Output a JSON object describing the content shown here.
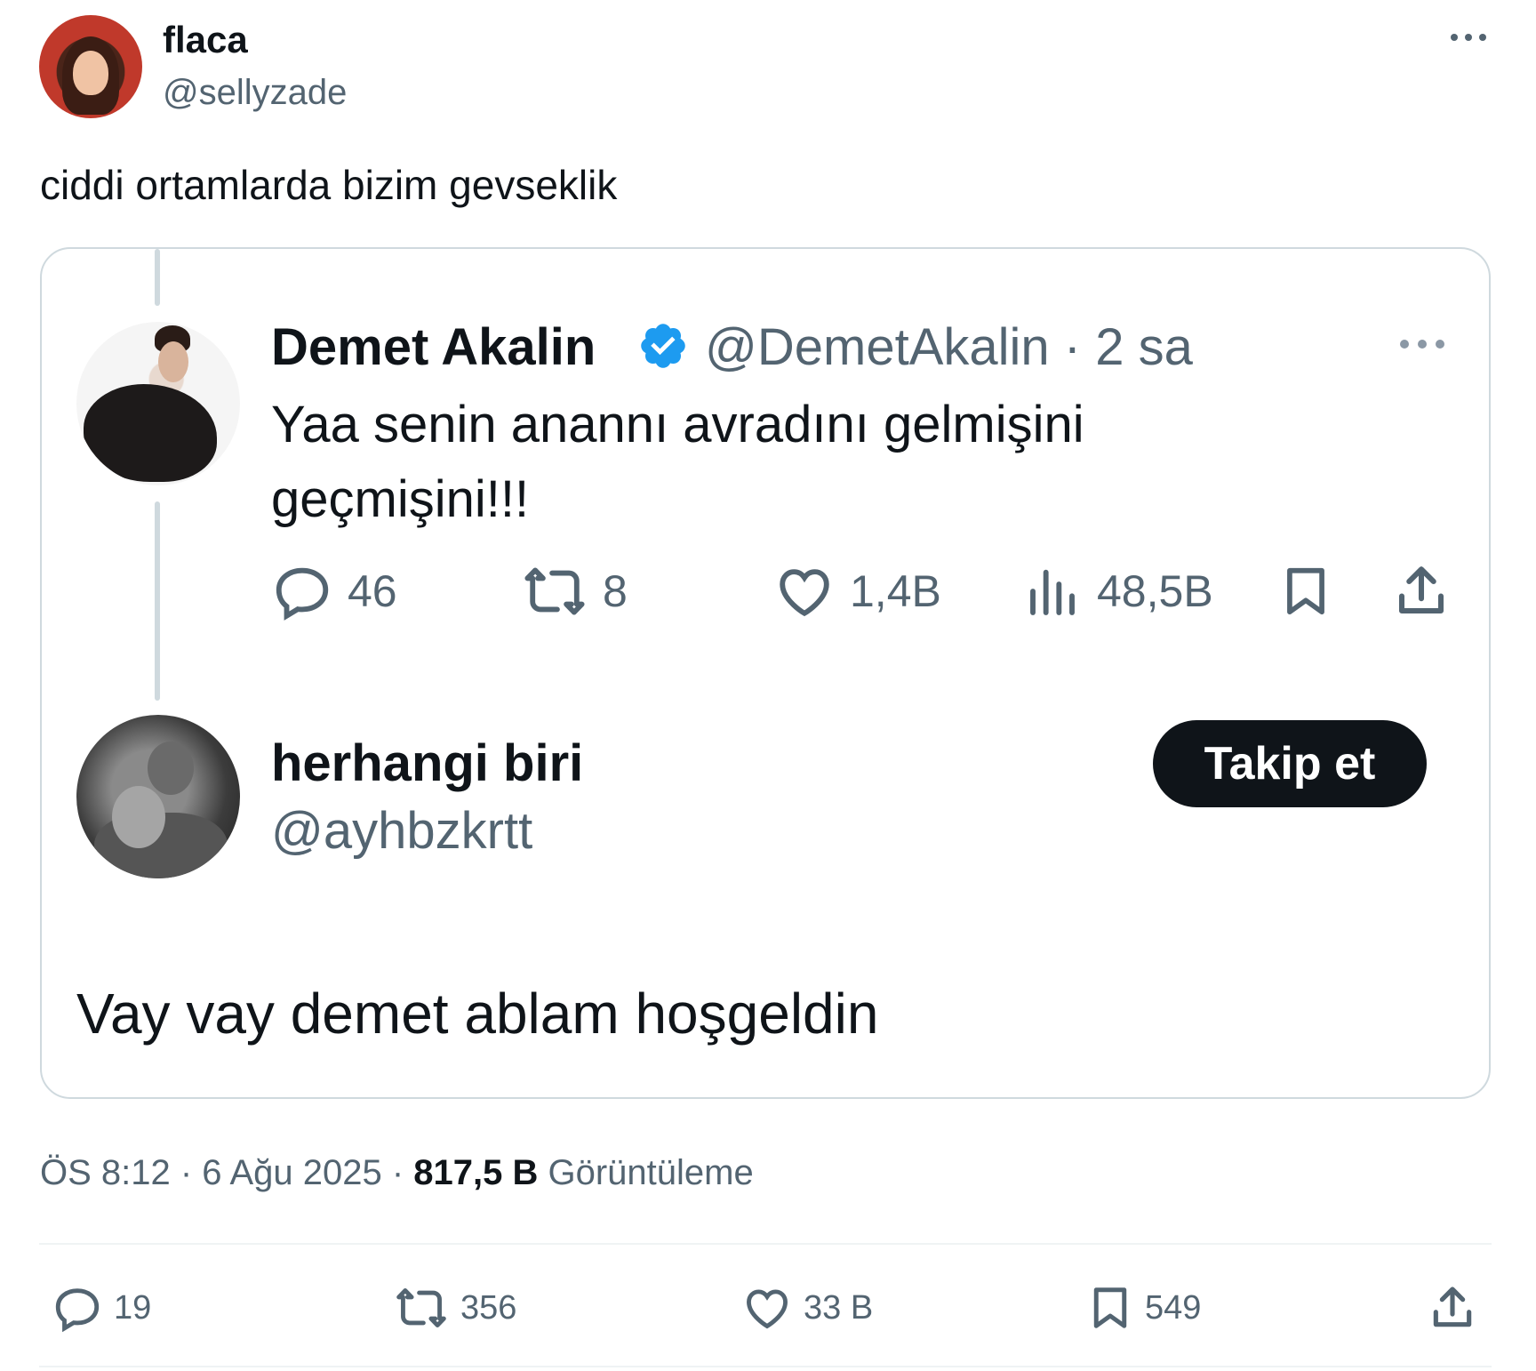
{
  "author": {
    "name": "flaca",
    "handle": "@sellyzade"
  },
  "tweet_text": "ciddi ortamlarda bizim gevseklik",
  "quoted": {
    "original": {
      "name": "Demet Akalin",
      "handle_time": "@DemetAkalin · 2 sa",
      "text": "Yaa senin anannı avradını gelmişini geçmişini!!!",
      "stats": {
        "replies": "46",
        "retweets": "8",
        "likes": "1,4B",
        "views": "48,5B"
      }
    },
    "reply": {
      "name": "herhangi biri",
      "handle": "@ayhbzkrtt",
      "follow_label": "Takip et",
      "text": "Vay vay demet ablam hoşgeldin"
    }
  },
  "meta": {
    "time_date": "ÖS 8:12 · 6 Ağu 2025 · ",
    "views_count": "817,5 B",
    "views_label": " Görüntüleme"
  },
  "actions": {
    "replies": "19",
    "retweets": "356",
    "likes": "33 B",
    "bookmarks": "549"
  },
  "colors": {
    "text": "#0f1419",
    "secondary": "#536471",
    "border": "#cfd9de",
    "verified": "#1d9bf0"
  },
  "icons": [
    "more-icon",
    "verified-icon",
    "reply-icon",
    "retweet-icon",
    "like-icon",
    "views-icon",
    "bookmark-icon",
    "share-icon"
  ]
}
